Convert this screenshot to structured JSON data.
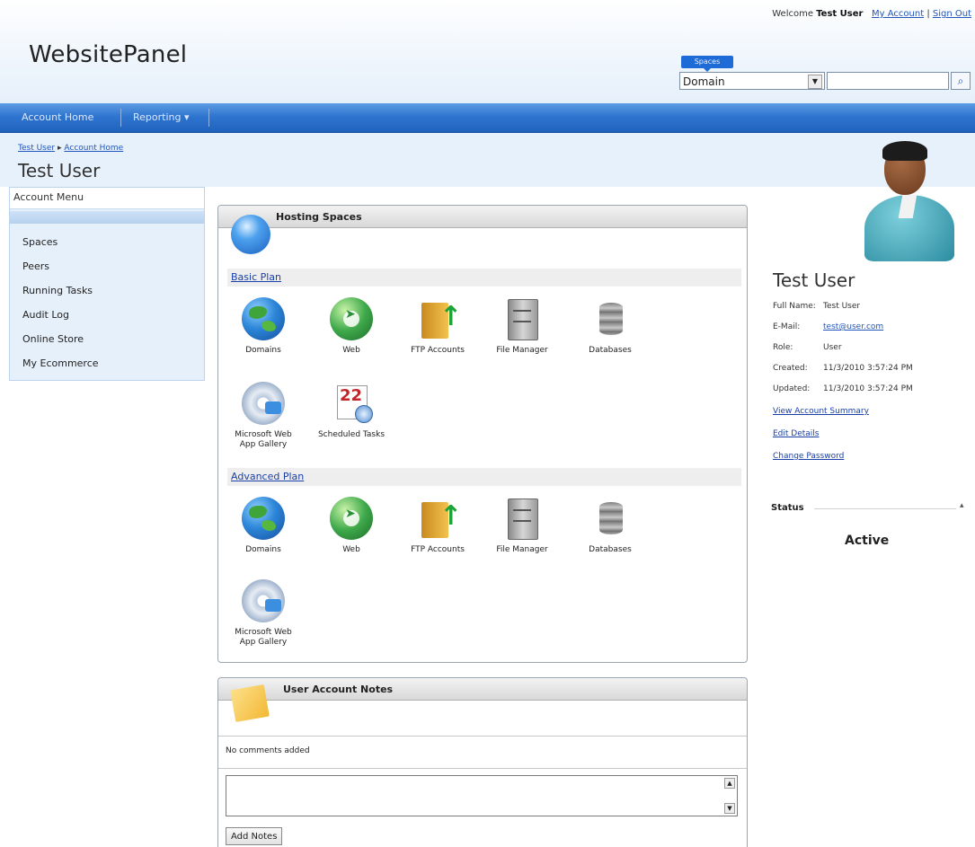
{
  "header": {
    "welcome_prefix": "Welcome",
    "welcome_user": "Test User",
    "my_account": "My Account",
    "sep": "|",
    "sign_out": "Sign Out",
    "brand": "WebsitePanel",
    "search_tag": "Spaces",
    "search_type": "Domain",
    "search_value": "",
    "search_type_arrow": "▼",
    "search_icon": "magnifier-icon"
  },
  "nav": {
    "account_home": "Account Home",
    "reporting": "Reporting ▾"
  },
  "breadcrumb": {
    "item1": "Test User",
    "arrow": "▸",
    "item2": "Account Home"
  },
  "page_title": "Test User",
  "menu": {
    "title": "Account Menu",
    "items": [
      "Spaces",
      "Peers",
      "Running Tasks",
      "Audit Log",
      "Online Store",
      "My Ecommerce"
    ]
  },
  "hosting": {
    "title": "Hosting Spaces",
    "plans": [
      {
        "name": "Basic Plan",
        "tiles": [
          {
            "label": "Domains",
            "icon": "globe-icon"
          },
          {
            "label": "Web",
            "icon": "web-icon"
          },
          {
            "label": "FTP Accounts",
            "icon": "ftp-folder-icon"
          },
          {
            "label": "File Manager",
            "icon": "file-cabinet-icon"
          },
          {
            "label": "Databases",
            "icon": "database-icon"
          },
          {
            "label": "Microsoft Web App Gallery",
            "icon": "web-app-gallery-icon"
          },
          {
            "label": "Scheduled Tasks",
            "icon": "calendar-clock-icon"
          }
        ]
      },
      {
        "name": "Advanced Plan",
        "tiles": [
          {
            "label": "Domains",
            "icon": "globe-icon"
          },
          {
            "label": "Web",
            "icon": "web-icon"
          },
          {
            "label": "FTP Accounts",
            "icon": "ftp-folder-icon"
          },
          {
            "label": "File Manager",
            "icon": "file-cabinet-icon"
          },
          {
            "label": "Databases",
            "icon": "database-icon"
          },
          {
            "label": "Microsoft Web App Gallery",
            "icon": "web-app-gallery-icon"
          }
        ]
      }
    ]
  },
  "notes": {
    "title": "User Account Notes",
    "empty_text": "No comments added",
    "add_button": "Add Notes",
    "textarea_value": ""
  },
  "profile": {
    "name": "Test User",
    "full_name_label": "Full Name:",
    "full_name": "Test User",
    "email_label": "E-Mail:",
    "email": "test@user.com",
    "role_label": "Role:",
    "role": "User",
    "created_label": "Created:",
    "created": "11/3/2010 3:57:24 PM",
    "updated_label": "Updated:",
    "updated": "11/3/2010 3:57:24 PM",
    "links": [
      "View Account Summary",
      "Edit Details",
      "Change Password"
    ]
  },
  "status": {
    "label": "Status",
    "caret": "▴",
    "value": "Active"
  },
  "colors": {
    "nav_blue": "#2f75cf",
    "link_blue": "#1a3fa6",
    "subheader_bg": "#e7f1fb"
  }
}
